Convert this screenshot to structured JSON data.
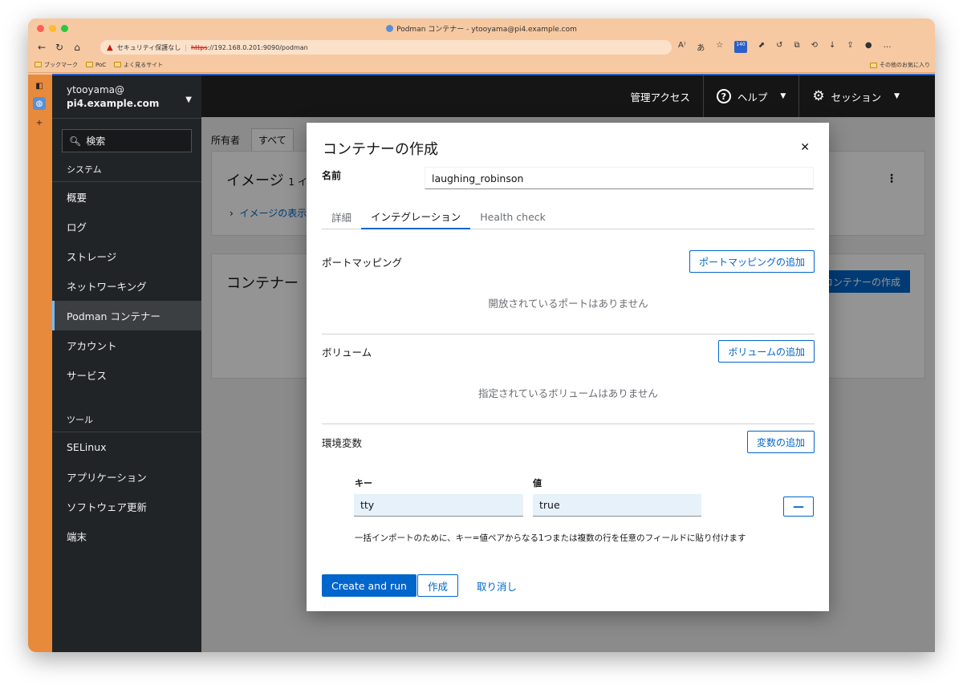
{
  "browser": {
    "window_title": "Podman コンテナー - ytooyama@pi4.example.com",
    "security_label": "セキュリティ保護なし",
    "url_scheme": "https",
    "url_rest": "://192.168.0.201:9090/podman",
    "bookmarks": [
      "ブックマーク",
      "PoC",
      "よく見るサイト"
    ],
    "other_bookmarks": "その他のお気に入り",
    "badge": "140"
  },
  "sidebar": {
    "user": "ytooyama@",
    "host": "pi4.example.com",
    "search": "検索",
    "system_title": "システム",
    "system_items": [
      "概要",
      "ログ",
      "ストレージ",
      "ネットワーキング",
      "Podman コンテナー",
      "アカウント",
      "サービス"
    ],
    "tools_title": "ツール",
    "tools_items": [
      "SELinux",
      "アプリケーション",
      "ソフトウェア更新",
      "端末"
    ]
  },
  "topbar": {
    "admin": "管理アクセス",
    "help": "ヘルプ",
    "session": "セッション"
  },
  "background": {
    "owner_label": "所有者",
    "owner_value": "すべて",
    "images_title": "イメージ",
    "images_count": "1 イ",
    "images_expand": "イメージの表示",
    "containers_title": "コンテナー",
    "create_container": "コンテナーの作成"
  },
  "modal": {
    "title": "コンテナーの作成",
    "name_label": "名前",
    "name_value": "laughing_robinson",
    "tabs": [
      "詳細",
      "インテグレーション",
      "Health check"
    ],
    "ports_label": "ポートマッピング",
    "ports_add": "ポートマッピングの追加",
    "ports_empty": "開放されているポートはありません",
    "volumes_label": "ボリューム",
    "volumes_add": "ボリュームの追加",
    "volumes_empty": "指定されているボリュームはありません",
    "env_label": "環境変数",
    "env_add": "変数の追加",
    "env_key_label": "キー",
    "env_value_label": "値",
    "env_key": "tty",
    "env_value": "true",
    "env_hint": "一括インポートのために、キー=値ペアからなる1つまたは複数の行を任意のフィールドに貼り付けます",
    "btn_create_run": "Create and run",
    "btn_create": "作成",
    "btn_cancel": "取り消し"
  }
}
